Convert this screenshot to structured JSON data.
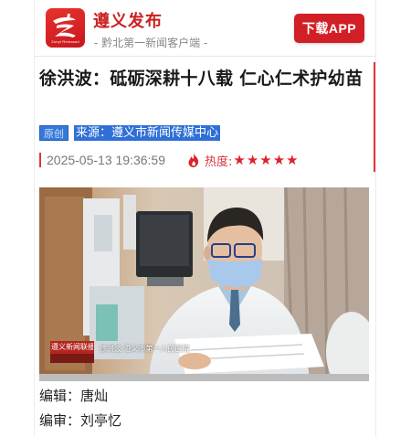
{
  "header": {
    "app_name": "遵义发布",
    "tagline": "- 黔北第一新闻客户端 -",
    "download_label": "下载APP",
    "logo_subtext": "Zunyi Released"
  },
  "article": {
    "title": "徐洪波：砥砺深耕十八载 仁心仁术护幼苗",
    "tag_original": "原创",
    "source": "来源：遵义市新闻传媒中心",
    "date": "2025-05-13 19:36:59",
    "heat_label": "热度:",
    "heat_rating": 5,
    "heat_stars": "★★★★★"
  },
  "photo": {
    "watermark_title": "遵义新闻联播",
    "caption": "徐洪波 遵义市第一人民医院"
  },
  "credits": {
    "editor": "编辑：唐灿",
    "reviewer": "编审：刘亭忆"
  },
  "colors": {
    "brand_red": "#d21f26",
    "tag_blue": "#2f6fd6",
    "star_red": "#e0202a"
  }
}
